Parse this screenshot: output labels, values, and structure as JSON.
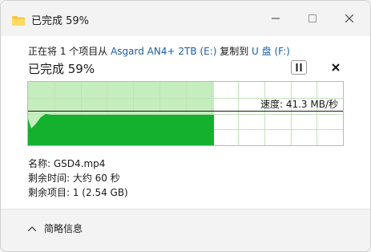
{
  "window": {
    "title": "已完成 59%",
    "colors": {
      "progress_fill": "#13b12e",
      "progress_bg": "#c5edbe",
      "grid": "#bfe3b7",
      "link": "#1a5fa8"
    }
  },
  "status": {
    "prefix": "正在将 1 个项目从",
    "source": "Asgard AN4+ 2TB (E:)",
    "middle": "复制到",
    "destination": "U 盘 (F:)"
  },
  "progress": {
    "title": "已完成 59%",
    "percent": 59,
    "speed_label": "速度: 41.3 MB/秒"
  },
  "controls": {
    "pause_icon": "pause-icon",
    "cancel_icon": "close-icon"
  },
  "details": {
    "name": "名称: GSD4.mp4",
    "time_left": "剩余时间: 大约 60 秒",
    "items_left": "剩余项目: 1 (2.54 GB)"
  },
  "footer": {
    "toggle_label": "简略信息",
    "toggle_icon": "chevron-up-icon"
  }
}
